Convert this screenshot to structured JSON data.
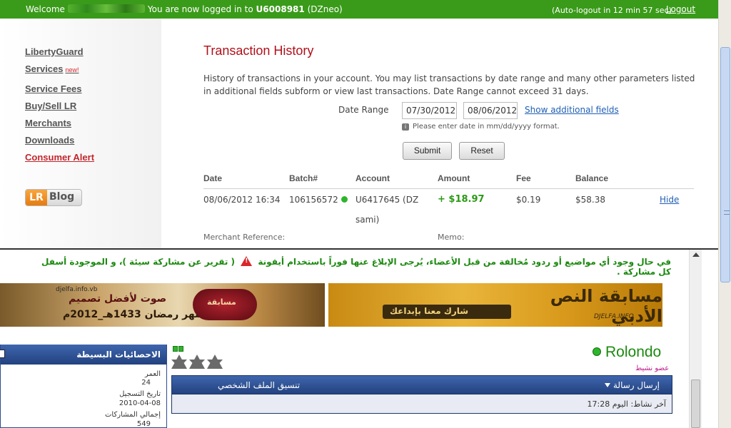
{
  "topbar": {
    "welcome": "Welcome",
    "logged_in_text": "You are now logged in to",
    "account_id": "U6008981",
    "account_tag": "(DZneo)",
    "autologout": "(Auto-logout in 12 min 57 sec)",
    "logout": "Logout",
    "bar_color": "#3a9b1a"
  },
  "sidebar": {
    "items": [
      {
        "label": "LibertyGuard"
      },
      {
        "label": "Services",
        "badge": "new!"
      },
      {
        "label": "Service Fees"
      },
      {
        "label": "Buy/Sell LR"
      },
      {
        "label": "Merchants"
      },
      {
        "label": "Downloads"
      },
      {
        "label": "Consumer Alert"
      }
    ],
    "blog_button": {
      "lr": "LR",
      "blog": "Blog"
    }
  },
  "main": {
    "title": "Transaction History",
    "description": "History of transactions in your account. You may list transactions by date range and many other parameters listed in additional fields subform or view last transactions. Date Range cannot exceed 31 days.",
    "date_range_label": "Date Range",
    "date_from": "07/30/2012",
    "date_to": "08/06/2012",
    "show_fields": "Show additional fields",
    "hint": "Please enter date in mm/dd/yyyy format.",
    "submit": "Submit",
    "reset": "Reset",
    "columns": [
      "Date",
      "Batch#",
      "Account",
      "Amount",
      "Fee",
      "Balance"
    ],
    "row": {
      "date": "08/06/2012 16:34",
      "batch": "106156572",
      "account_line1": "U6417645 (DZ",
      "account_line2": "sami)",
      "amount": "+ $18.97",
      "fee": "$0.19",
      "balance": "$58.38",
      "action": "Hide"
    },
    "merchant_ref_label": "Merchant Reference:",
    "memo_label": "Memo:"
  },
  "forum": {
    "notice_part1": "في حال وجود أي مواضيع أو ردود مُخالفة من قبل الأعضاء، يُرجى الإبلاغ عنها فوراً باستخدام أيقونة",
    "notice_part2": "( تقرير عن مشاركة سيئة )، و الموجودة أسفل كل مشاركة .",
    "banner1": {
      "site": "djelfa.info.vb",
      "headline": "صوت لأفضل تصميم",
      "badge": "مسابقة",
      "date": "لشهر رمضان 1433هـ_2012م"
    },
    "banner2": {
      "headline": "مسابقة النص الأدبي",
      "bar": "شارك معنا بإبداعك",
      "url": "DJELFA.INFO"
    },
    "stats": {
      "title": "الاحصائيات البسيطة",
      "age_label": "العمر",
      "age": "24",
      "reg_label": "تاريخ التسجيل",
      "reg_date": "2010-04-08",
      "posts_label": "إجمالي المشاركات",
      "posts": "549"
    },
    "profile": {
      "username": "Rolondo",
      "subtitle": "عضو نشيط",
      "send_message": "إرسال رسالة",
      "theme": "تنسيق الملف الشخصي",
      "last_activity": "آخر نشاط: اليوم 17:28"
    }
  }
}
